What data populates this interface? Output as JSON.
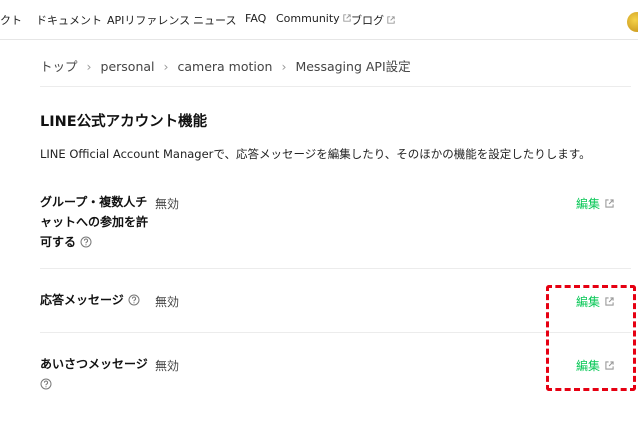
{
  "nav": {
    "items": [
      {
        "label": "クト",
        "external": false
      },
      {
        "label": "ドキュメント",
        "external": false
      },
      {
        "label": "APIリファレンス",
        "external": false
      },
      {
        "label": "ニュース",
        "external": false
      },
      {
        "label": "FAQ",
        "external": false
      },
      {
        "label": "Community",
        "external": true
      },
      {
        "label": "ブログ",
        "external": true
      }
    ]
  },
  "breadcrumb": [
    "トップ",
    "personal",
    "camera motion",
    "Messaging API設定"
  ],
  "section": {
    "title": "LINE公式アカウント機能",
    "description": "LINE Official Account Managerで、応答メッセージを編集したり、そのほかの機能を設定したりします。"
  },
  "rows": [
    {
      "label_lines": [
        "グループ・複数人チ",
        "ャットへの参加を許",
        "可する"
      ],
      "value": "無効",
      "action": "編集"
    },
    {
      "label_lines": [
        "応答メッセージ"
      ],
      "value": "無効",
      "action": "編集"
    },
    {
      "label_lines": [
        "あいさつメッセージ",
        ""
      ],
      "value": "無効",
      "action": "編集"
    }
  ],
  "colors": {
    "link": "#06c755",
    "highlight": "#e60012"
  },
  "icons": {
    "external": "external-link-icon",
    "help": "help-circle-icon"
  }
}
